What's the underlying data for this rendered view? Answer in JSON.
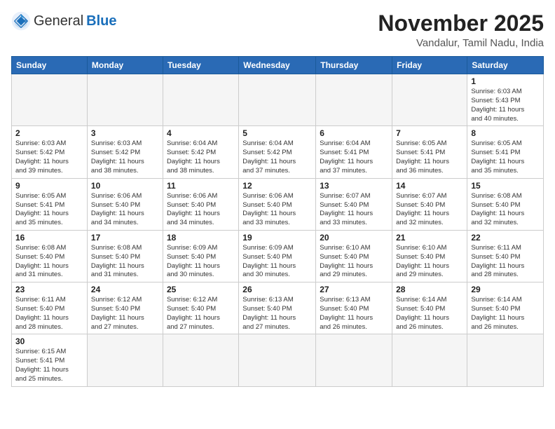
{
  "header": {
    "logo_general": "General",
    "logo_blue": "Blue",
    "month_title": "November 2025",
    "location": "Vandalur, Tamil Nadu, India"
  },
  "weekdays": [
    "Sunday",
    "Monday",
    "Tuesday",
    "Wednesday",
    "Thursday",
    "Friday",
    "Saturday"
  ],
  "weeks": [
    [
      {
        "day": "",
        "info": ""
      },
      {
        "day": "",
        "info": ""
      },
      {
        "day": "",
        "info": ""
      },
      {
        "day": "",
        "info": ""
      },
      {
        "day": "",
        "info": ""
      },
      {
        "day": "",
        "info": ""
      },
      {
        "day": "1",
        "info": "Sunrise: 6:03 AM\nSunset: 5:43 PM\nDaylight: 11 hours\nand 40 minutes."
      }
    ],
    [
      {
        "day": "2",
        "info": "Sunrise: 6:03 AM\nSunset: 5:42 PM\nDaylight: 11 hours\nand 39 minutes."
      },
      {
        "day": "3",
        "info": "Sunrise: 6:03 AM\nSunset: 5:42 PM\nDaylight: 11 hours\nand 38 minutes."
      },
      {
        "day": "4",
        "info": "Sunrise: 6:04 AM\nSunset: 5:42 PM\nDaylight: 11 hours\nand 38 minutes."
      },
      {
        "day": "5",
        "info": "Sunrise: 6:04 AM\nSunset: 5:42 PM\nDaylight: 11 hours\nand 37 minutes."
      },
      {
        "day": "6",
        "info": "Sunrise: 6:04 AM\nSunset: 5:41 PM\nDaylight: 11 hours\nand 37 minutes."
      },
      {
        "day": "7",
        "info": "Sunrise: 6:05 AM\nSunset: 5:41 PM\nDaylight: 11 hours\nand 36 minutes."
      },
      {
        "day": "8",
        "info": "Sunrise: 6:05 AM\nSunset: 5:41 PM\nDaylight: 11 hours\nand 35 minutes."
      }
    ],
    [
      {
        "day": "9",
        "info": "Sunrise: 6:05 AM\nSunset: 5:41 PM\nDaylight: 11 hours\nand 35 minutes."
      },
      {
        "day": "10",
        "info": "Sunrise: 6:06 AM\nSunset: 5:40 PM\nDaylight: 11 hours\nand 34 minutes."
      },
      {
        "day": "11",
        "info": "Sunrise: 6:06 AM\nSunset: 5:40 PM\nDaylight: 11 hours\nand 34 minutes."
      },
      {
        "day": "12",
        "info": "Sunrise: 6:06 AM\nSunset: 5:40 PM\nDaylight: 11 hours\nand 33 minutes."
      },
      {
        "day": "13",
        "info": "Sunrise: 6:07 AM\nSunset: 5:40 PM\nDaylight: 11 hours\nand 33 minutes."
      },
      {
        "day": "14",
        "info": "Sunrise: 6:07 AM\nSunset: 5:40 PM\nDaylight: 11 hours\nand 32 minutes."
      },
      {
        "day": "15",
        "info": "Sunrise: 6:08 AM\nSunset: 5:40 PM\nDaylight: 11 hours\nand 32 minutes."
      }
    ],
    [
      {
        "day": "16",
        "info": "Sunrise: 6:08 AM\nSunset: 5:40 PM\nDaylight: 11 hours\nand 31 minutes."
      },
      {
        "day": "17",
        "info": "Sunrise: 6:08 AM\nSunset: 5:40 PM\nDaylight: 11 hours\nand 31 minutes."
      },
      {
        "day": "18",
        "info": "Sunrise: 6:09 AM\nSunset: 5:40 PM\nDaylight: 11 hours\nand 30 minutes."
      },
      {
        "day": "19",
        "info": "Sunrise: 6:09 AM\nSunset: 5:40 PM\nDaylight: 11 hours\nand 30 minutes."
      },
      {
        "day": "20",
        "info": "Sunrise: 6:10 AM\nSunset: 5:40 PM\nDaylight: 11 hours\nand 29 minutes."
      },
      {
        "day": "21",
        "info": "Sunrise: 6:10 AM\nSunset: 5:40 PM\nDaylight: 11 hours\nand 29 minutes."
      },
      {
        "day": "22",
        "info": "Sunrise: 6:11 AM\nSunset: 5:40 PM\nDaylight: 11 hours\nand 28 minutes."
      }
    ],
    [
      {
        "day": "23",
        "info": "Sunrise: 6:11 AM\nSunset: 5:40 PM\nDaylight: 11 hours\nand 28 minutes."
      },
      {
        "day": "24",
        "info": "Sunrise: 6:12 AM\nSunset: 5:40 PM\nDaylight: 11 hours\nand 27 minutes."
      },
      {
        "day": "25",
        "info": "Sunrise: 6:12 AM\nSunset: 5:40 PM\nDaylight: 11 hours\nand 27 minutes."
      },
      {
        "day": "26",
        "info": "Sunrise: 6:13 AM\nSunset: 5:40 PM\nDaylight: 11 hours\nand 27 minutes."
      },
      {
        "day": "27",
        "info": "Sunrise: 6:13 AM\nSunset: 5:40 PM\nDaylight: 11 hours\nand 26 minutes."
      },
      {
        "day": "28",
        "info": "Sunrise: 6:14 AM\nSunset: 5:40 PM\nDaylight: 11 hours\nand 26 minutes."
      },
      {
        "day": "29",
        "info": "Sunrise: 6:14 AM\nSunset: 5:40 PM\nDaylight: 11 hours\nand 26 minutes."
      }
    ],
    [
      {
        "day": "30",
        "info": "Sunrise: 6:15 AM\nSunset: 5:41 PM\nDaylight: 11 hours\nand 25 minutes."
      },
      {
        "day": "",
        "info": ""
      },
      {
        "day": "",
        "info": ""
      },
      {
        "day": "",
        "info": ""
      },
      {
        "day": "",
        "info": ""
      },
      {
        "day": "",
        "info": ""
      },
      {
        "day": "",
        "info": ""
      }
    ]
  ]
}
